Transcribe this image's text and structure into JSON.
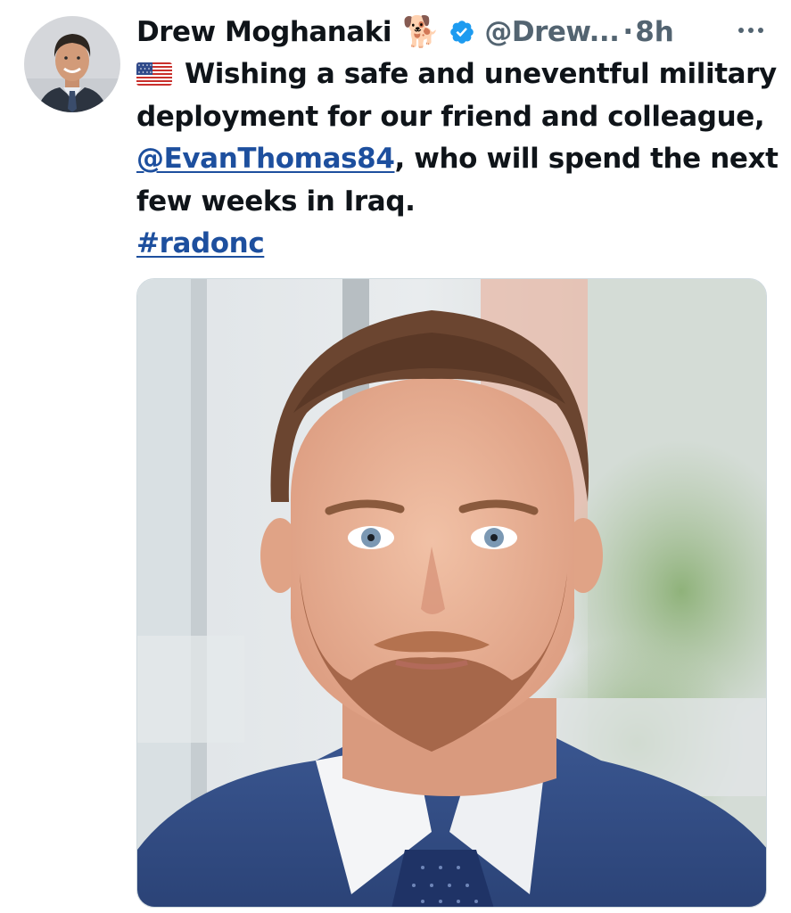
{
  "tweet": {
    "author_name": "Drew Moghanaki",
    "author_emoji": "🐕",
    "handle": "@Drew...",
    "separator": "·",
    "time": "8h",
    "text": {
      "part1": "Wishing a safe and uneventful military deployment for our friend and colleague, ",
      "mention": "@EvanThomas84",
      "part2": ", who will spend the next few weeks in Iraq.",
      "hashtag": "#radonc"
    }
  },
  "colors": {
    "link": "#1d4f9e",
    "verified": "#1d9bf0",
    "secondary_text": "#536471"
  },
  "icons": {
    "verified": "verified-badge-icon",
    "more": "more-options-icon",
    "flag": "us-flag-emoji"
  }
}
